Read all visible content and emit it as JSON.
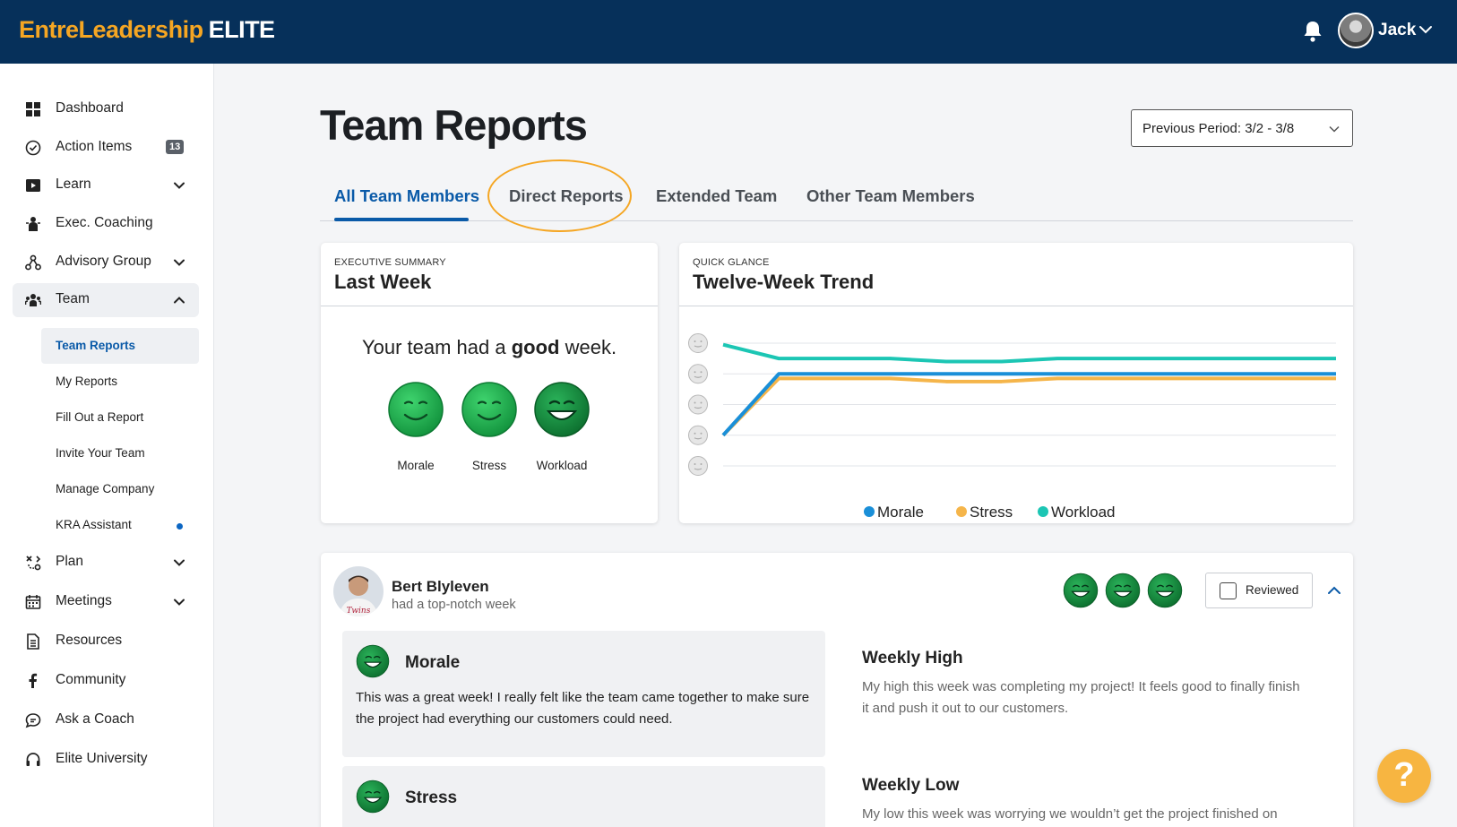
{
  "brand": {
    "part1": "EntreLeadership",
    "part2": "ELITE"
  },
  "user": {
    "name": "Jack"
  },
  "colors": {
    "navy": "#06305a",
    "accent": "#f5a623",
    "link": "#0a5aa8",
    "morale": "#1a8fd8",
    "stress": "#f5b54a",
    "workload": "#1cc6b4",
    "face_green": "#19a84a"
  },
  "sidebar": {
    "items": [
      {
        "label": "Dashboard",
        "icon": "grid-icon"
      },
      {
        "label": "Action Items",
        "icon": "check-circle-icon",
        "badge": "13"
      },
      {
        "label": "Learn",
        "icon": "play-icon"
      },
      {
        "label": "Exec. Coaching",
        "icon": "coach-icon"
      },
      {
        "label": "Advisory Group",
        "icon": "network-icon"
      },
      {
        "label": "Team",
        "icon": "team-icon"
      },
      {
        "label": "Plan",
        "icon": "plan-icon"
      },
      {
        "label": "Meetings",
        "icon": "calendar-icon"
      },
      {
        "label": "Resources",
        "icon": "document-icon"
      },
      {
        "label": "Community",
        "icon": "facebook-icon"
      },
      {
        "label": "Ask a Coach",
        "icon": "chat-icon"
      },
      {
        "label": "Elite University",
        "icon": "headset-icon"
      }
    ],
    "team_sub": [
      {
        "label": "Team Reports"
      },
      {
        "label": "My Reports"
      },
      {
        "label": "Fill Out a Report"
      },
      {
        "label": "Invite Your Team"
      },
      {
        "label": "Manage Company"
      },
      {
        "label": "KRA Assistant"
      }
    ]
  },
  "page": {
    "title": "Team Reports",
    "period": "Previous Period: 3/2 - 3/8",
    "tabs": [
      "All Team Members",
      "Direct Reports",
      "Extended Team",
      "Other Team Members"
    ]
  },
  "summary": {
    "kicker": "EXECUTIVE SUMMARY",
    "title": "Last Week",
    "text_pre": "Your team had a ",
    "text_bold": "good",
    "text_post": " week.",
    "faces": [
      {
        "label": "Morale",
        "level": 4
      },
      {
        "label": "Stress",
        "level": 4
      },
      {
        "label": "Workload",
        "level": 5
      }
    ]
  },
  "trend": {
    "kicker": "QUICK GLANCE",
    "title": "Twelve-Week Trend",
    "legend": [
      "Morale",
      "Stress",
      "Workload"
    ]
  },
  "chart_data": {
    "type": "line",
    "title": "Twelve-Week Trend",
    "ylim": [
      1,
      5
    ],
    "x": [
      1,
      2,
      3,
      4,
      5,
      6,
      7,
      8,
      9,
      10,
      11,
      12
    ],
    "grid": true,
    "legend_position": "bottom",
    "series": [
      {
        "name": "Morale",
        "values": [
          2.0,
          4.0,
          4.0,
          4.0,
          4.0,
          4.0,
          4.0,
          4.0,
          4.0,
          4.0,
          4.0,
          4.0
        ]
      },
      {
        "name": "Stress",
        "values": [
          2.0,
          3.85,
          3.85,
          3.85,
          3.75,
          3.75,
          3.85,
          3.85,
          3.85,
          3.85,
          3.85,
          3.85
        ]
      },
      {
        "name": "Workload",
        "values": [
          4.95,
          4.5,
          4.5,
          4.5,
          4.4,
          4.4,
          4.5,
          4.5,
          4.5,
          4.5,
          4.5,
          4.5
        ]
      }
    ]
  },
  "member": {
    "name": "Bert Blyleven",
    "subtitle": "had a top-notch week",
    "reviewed_label": "Reviewed",
    "morale": {
      "label": "Morale",
      "text": "This was a great week! I really felt like the team came together to make sure the project had everything our customers could need."
    },
    "stress": {
      "label": "Stress"
    },
    "weekly_high": {
      "label": "Weekly High",
      "text": "My high this week was completing my project! It feels good to finally finish it and push it out to our customers."
    },
    "weekly_low": {
      "label": "Weekly Low",
      "text": "My low this week was worrying we wouldn’t get the project finished on"
    }
  },
  "help": {
    "label": "?"
  }
}
